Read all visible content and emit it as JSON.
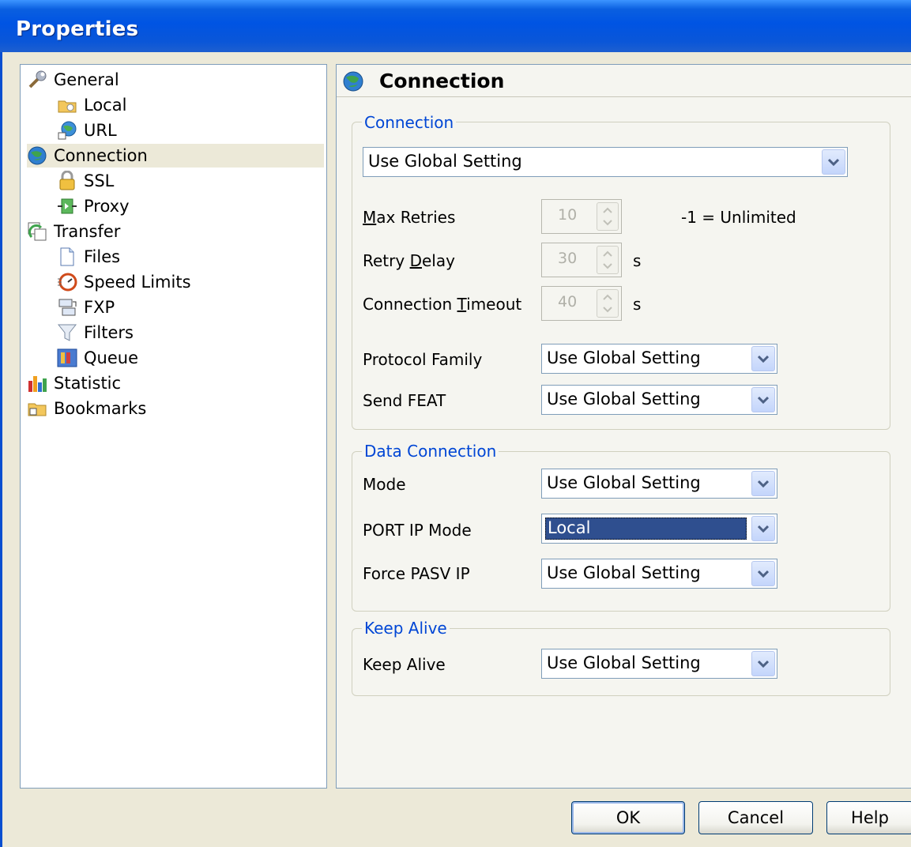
{
  "window": {
    "title": "Properties"
  },
  "tree": [
    {
      "label": "General",
      "icon": "wrench-icon"
    },
    {
      "label": "Local",
      "icon": "local-folder-icon"
    },
    {
      "label": "URL",
      "icon": "globe-link-icon"
    },
    {
      "label": "Connection",
      "icon": "globe-icon",
      "selected": true
    },
    {
      "label": "SSL",
      "icon": "lock-icon"
    },
    {
      "label": "Proxy",
      "icon": "proxy-icon"
    },
    {
      "label": "Transfer",
      "icon": "transfer-icon"
    },
    {
      "label": "Files",
      "icon": "files-icon"
    },
    {
      "label": "Speed Limits",
      "icon": "speed-icon"
    },
    {
      "label": "FXP",
      "icon": "fxp-icon"
    },
    {
      "label": "Filters",
      "icon": "filter-icon"
    },
    {
      "label": "Queue",
      "icon": "queue-icon"
    },
    {
      "label": "Statistic",
      "icon": "bar-chart-icon"
    },
    {
      "label": "Bookmarks",
      "icon": "bookmark-folder-icon"
    }
  ],
  "panel": {
    "title": "Connection",
    "connection_group": {
      "label": "Connection",
      "main_select": "Use Global Setting",
      "max_retries": {
        "label_pre": "",
        "label_u": "M",
        "label_post": "ax Retries",
        "value": "10",
        "hint": "-1 = Unlimited"
      },
      "retry_delay": {
        "label_pre": "Retry ",
        "label_u": "D",
        "label_post": "elay",
        "value": "30",
        "unit": "s"
      },
      "timeout": {
        "label_pre": "Connection ",
        "label_u": "T",
        "label_post": "imeout",
        "value": "40",
        "unit": "s"
      },
      "protocol_family": {
        "label": "Protocol Family",
        "value": "Use Global Setting"
      },
      "send_feat": {
        "label": "Send FEAT",
        "value": "Use Global Setting"
      }
    },
    "data_group": {
      "label": "Data Connection",
      "mode": {
        "label": "Mode",
        "value": "Use Global Setting"
      },
      "port_ip_mode": {
        "label": "PORT IP Mode",
        "value": "Local"
      },
      "force_pasv_ip": {
        "label": "Force PASV IP",
        "value": "Use Global Setting"
      }
    },
    "keepalive_group": {
      "label": "Keep Alive",
      "keep_alive": {
        "label": "Keep Alive",
        "value": "Use Global Setting"
      }
    }
  },
  "buttons": {
    "ok": "OK",
    "cancel": "Cancel",
    "help": "Help"
  }
}
